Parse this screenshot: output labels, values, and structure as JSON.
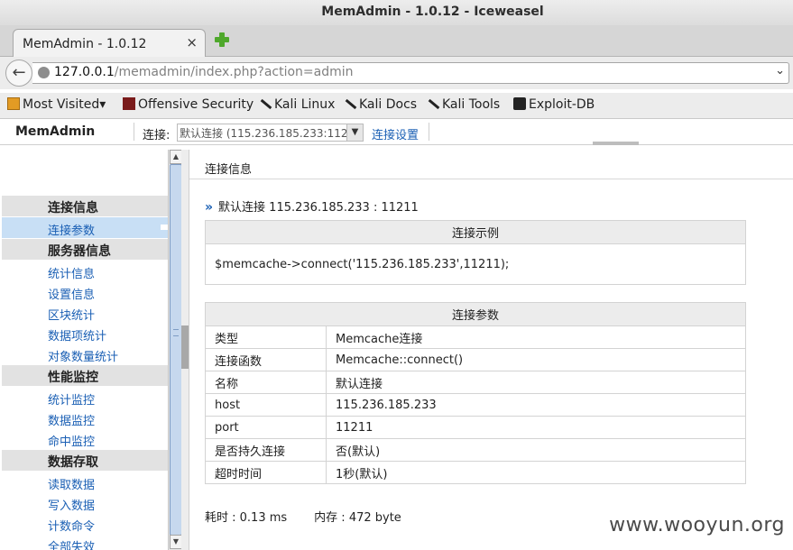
{
  "window": {
    "title": "MemAdmin - 1.0.12 - Iceweasel"
  },
  "tab": {
    "label": "MemAdmin - 1.0.12",
    "close": "×"
  },
  "url": {
    "host": "127.0.0.1",
    "path": "/memadmin/index.php?action=admin"
  },
  "bookmarks": [
    {
      "label": "Most Visited▾",
      "icon": "most-visited-icon"
    },
    {
      "label": "Offensive Security",
      "icon": "offensive-security-icon"
    },
    {
      "label": "Kali Linux",
      "icon": "kali-dragon-icon"
    },
    {
      "label": "Kali Docs",
      "icon": "kali-dragon-icon"
    },
    {
      "label": "Kali Tools",
      "icon": "kali-dragon-icon"
    },
    {
      "label": "Exploit-DB",
      "icon": "exploit-db-icon"
    }
  ],
  "app": {
    "brand": "MemAdmin",
    "connection_label": "连接:",
    "connection_value": "默认连接 (115.236.185.233:112",
    "connection_settings": "连接设置"
  },
  "sidebar": {
    "groups": [
      {
        "title": "连接信息",
        "items": [
          "连接参数"
        ]
      },
      {
        "title": "服务器信息",
        "items": [
          "统计信息",
          "设置信息",
          "区块统计",
          "数据项统计",
          "对象数量统计"
        ]
      },
      {
        "title": "性能监控",
        "items": [
          "统计监控",
          "数据监控",
          "命中监控"
        ]
      },
      {
        "title": "数据存取",
        "items": [
          "读取数据",
          "写入数据",
          "计数命令",
          "全部失效"
        ]
      }
    ],
    "active": "连接参数"
  },
  "main": {
    "header": "连接信息",
    "connection_line": "默认连接 115.236.185.233 : 11211",
    "example": {
      "title": "连接示例",
      "code": "$memcache->connect('115.236.185.233',11211);"
    },
    "params": {
      "title": "连接参数",
      "rows": [
        {
          "k": "类型",
          "v": "Memcache连接"
        },
        {
          "k": "连接函数",
          "v": "Memcache::connect()"
        },
        {
          "k": "名称",
          "v": "默认连接"
        },
        {
          "k": "host",
          "v": "115.236.185.233"
        },
        {
          "k": "port",
          "v": "11211"
        },
        {
          "k": "是否持久连接",
          "v": "否(默认)"
        },
        {
          "k": "超时时间",
          "v": "1秒(默认)"
        }
      ]
    },
    "footer": {
      "time": "耗时 : 0.13 ms",
      "memory": "内存 : 472 byte"
    }
  },
  "watermark": "www.wooyun.org"
}
